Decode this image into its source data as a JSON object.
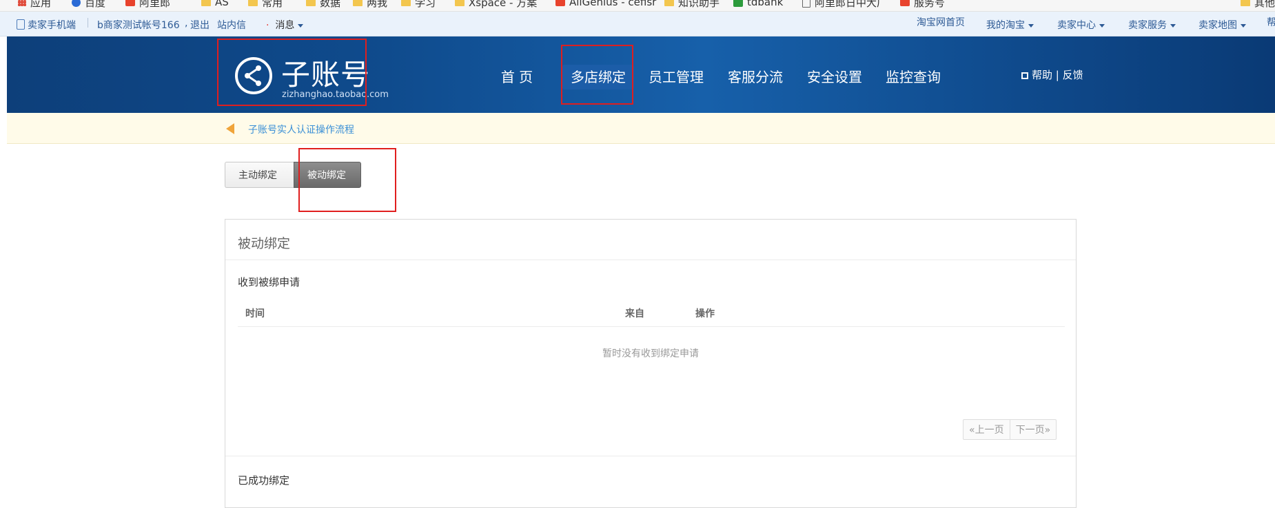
{
  "bookmarks": [
    {
      "label": "应用",
      "icon": "apps-grid-icon"
    },
    {
      "label": "百度",
      "icon": "baidu-paw-icon"
    },
    {
      "label": "阿里郎",
      "icon": "alilang-icon"
    },
    {
      "label": "AS",
      "icon": "folder-icon"
    },
    {
      "label": "常用",
      "icon": "folder-icon"
    },
    {
      "label": "数据",
      "icon": "folder-icon"
    },
    {
      "label": "两我",
      "icon": "folder-icon"
    },
    {
      "label": "学习",
      "icon": "folder-icon"
    },
    {
      "label": "Xspace - 方案",
      "icon": "folder-icon"
    },
    {
      "label": "AllGenius - cefisr",
      "icon": "alilang-icon"
    },
    {
      "label": "知识助手",
      "icon": "folder-icon"
    },
    {
      "label": "tdbank",
      "icon": "tdbank-icon"
    },
    {
      "label": "阿里郎日中大厂",
      "icon": "document-icon"
    },
    {
      "label": "服务号",
      "icon": "alilang-icon"
    },
    {
      "label": "其他",
      "icon": "folder-icon"
    }
  ],
  "topbar": {
    "mobile_link": "卖家手机端",
    "account": "b商家测试帐号166",
    "logout": "退出",
    "site_msg": "站内信",
    "messages": "消息",
    "taobao_home": "淘宝网首页",
    "my_taobao": "我的淘宝",
    "seller_center": "卖家中心",
    "seller_service": "卖家服务",
    "seller_map": "卖家地图",
    "help_cut": "帮"
  },
  "header": {
    "logo_title": "子账号",
    "logo_sub": "zizhanghao.taobao.com",
    "nav": [
      "首 页",
      "多店绑定",
      "员工管理",
      "客服分流",
      "安全设置",
      "监控查询"
    ],
    "help": "帮助",
    "divider": "|",
    "feedback": "反馈"
  },
  "notice": {
    "text": "子账号实人认证操作流程"
  },
  "tabs": {
    "active_binding": "主动绑定",
    "passive_binding": "被动绑定"
  },
  "panel": {
    "title": "被动绑定",
    "received_title": "收到被绑申请",
    "columns": {
      "time": "时间",
      "from": "来自",
      "action": "操作"
    },
    "empty_text": "暂时没有收到绑定申请",
    "prev_page": "«上一页",
    "next_page": "下一页»",
    "bound_title": "已成功绑定"
  },
  "colors": {
    "header_blue": "#0f4b8d",
    "annotation_red": "#e01e1e",
    "link_blue": "#2d5a95",
    "notice_bg": "#fffbe9"
  }
}
